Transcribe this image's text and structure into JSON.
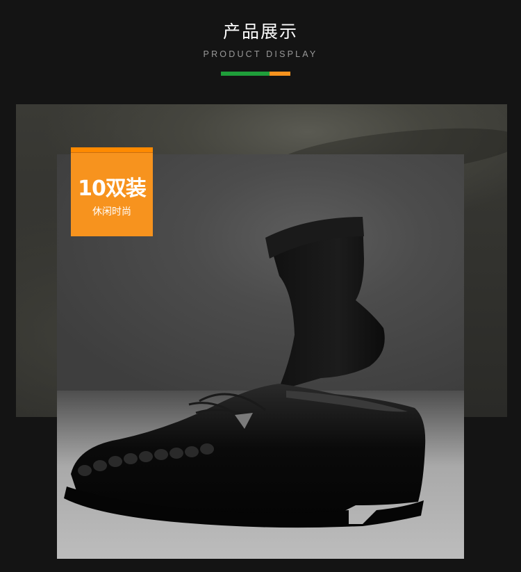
{
  "header": {
    "title": "产品展示",
    "subtitle": "PRODUCT DISPLAY"
  },
  "colors": {
    "accent_green": "#1f9e3a",
    "accent_orange": "#f7931e",
    "background": "#141414"
  },
  "badge": {
    "main_text": "10双装",
    "sub_text": "休闲时尚"
  },
  "photo": {
    "subject": "black-sock-and-leather-shoe"
  }
}
